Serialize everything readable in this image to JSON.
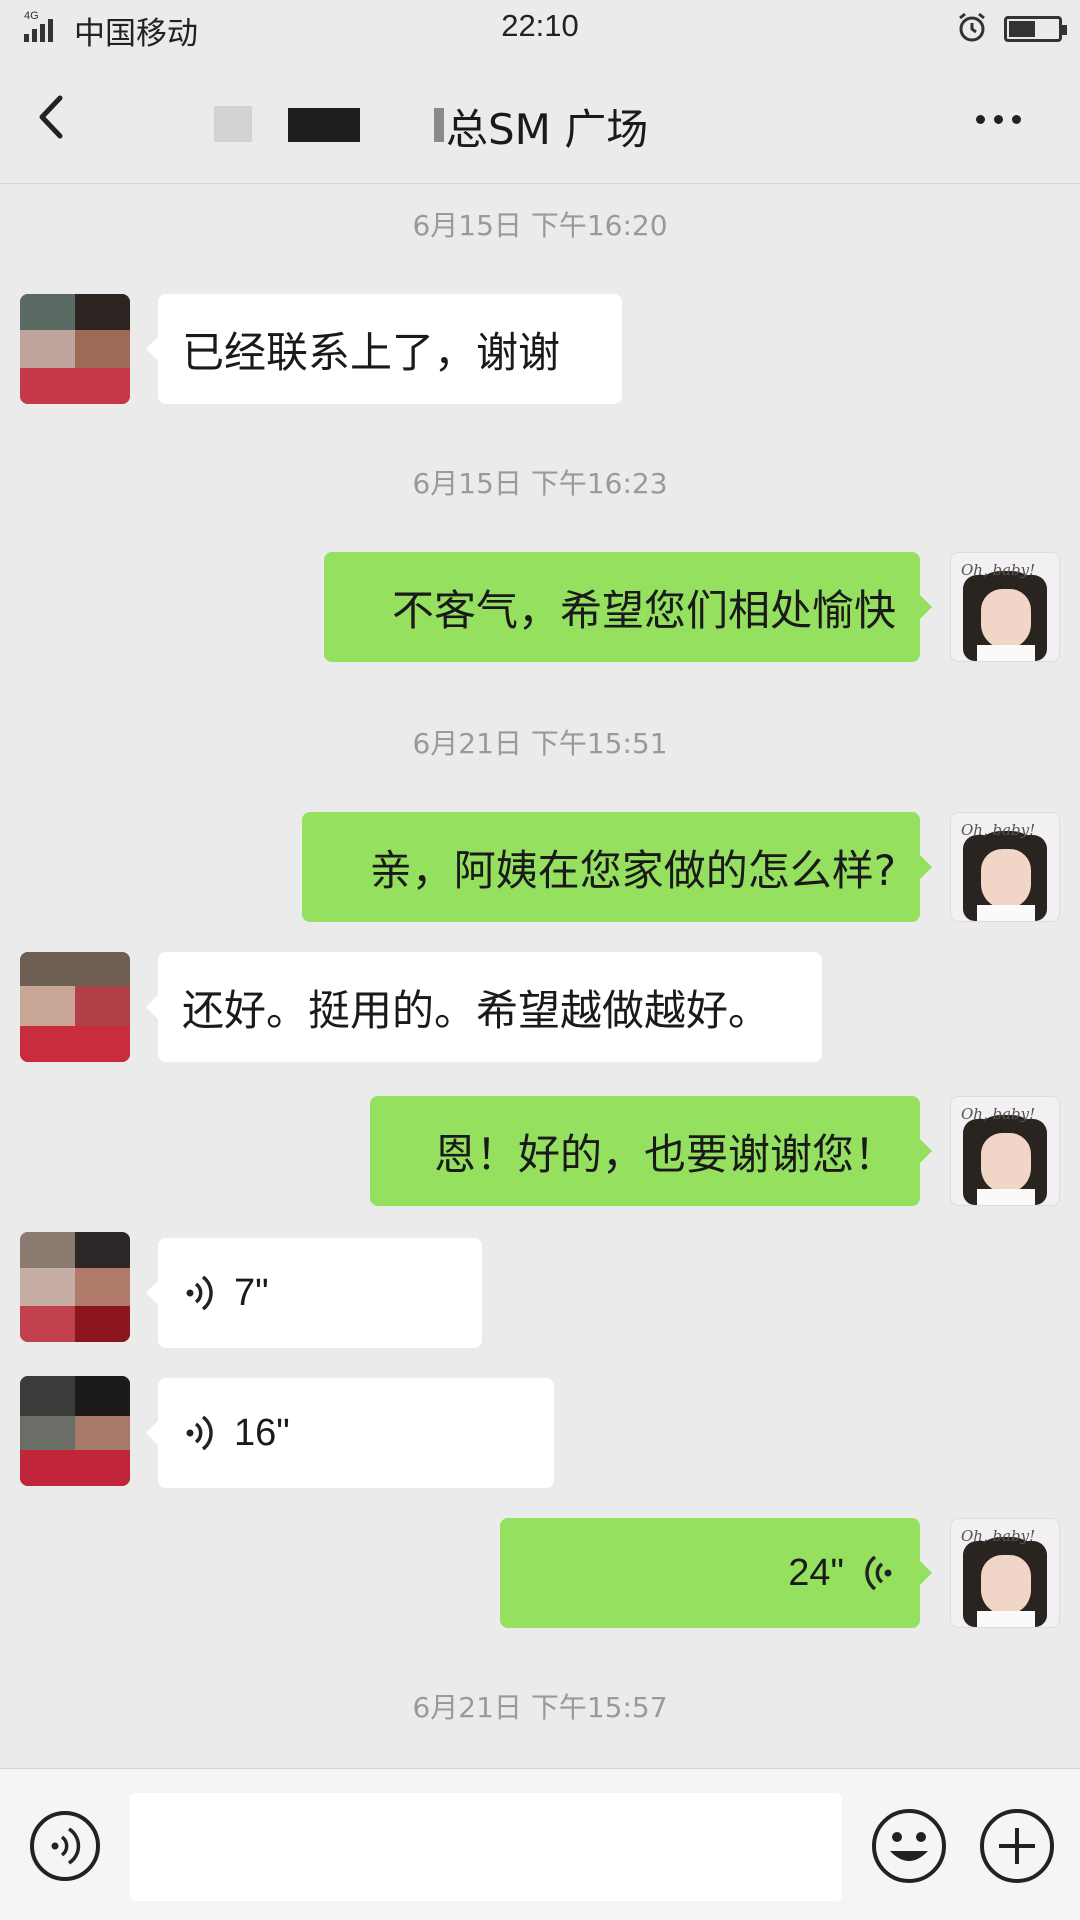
{
  "status_bar": {
    "network_tag": "4G",
    "carrier": "中国移动",
    "time": "22:10"
  },
  "header": {
    "title": "总SM 广场"
  },
  "messages": [
    {
      "type": "timestamp",
      "text": "6月15日 下午16:20"
    },
    {
      "type": "text",
      "side": "them",
      "text": "已经联系上了，谢谢"
    },
    {
      "type": "timestamp",
      "text": "6月15日 下午16:23"
    },
    {
      "type": "text",
      "side": "me",
      "text": "不客气，希望您们相处愉快"
    },
    {
      "type": "timestamp",
      "text": "6月21日 下午15:51"
    },
    {
      "type": "text",
      "side": "me",
      "text": "亲，阿姨在您家做的怎么样?"
    },
    {
      "type": "text",
      "side": "them",
      "text": "还好。挺用的。希望越做越好。"
    },
    {
      "type": "text",
      "side": "me",
      "text": "恩！好的，也要谢谢您！"
    },
    {
      "type": "voice",
      "side": "them",
      "duration": "7\""
    },
    {
      "type": "voice",
      "side": "them",
      "duration": "16\""
    },
    {
      "type": "voice",
      "side": "me",
      "duration": "24\""
    },
    {
      "type": "timestamp",
      "text": "6月21日 下午15:57"
    }
  ],
  "avatar_me_caption": "Oh, baby!",
  "input": {
    "placeholder": ""
  },
  "icons": {
    "back": "chevron-left-icon",
    "more": "more-dots-icon",
    "voice_toggle": "voice-icon",
    "emoji": "smiley-icon",
    "plus": "plus-circle-icon"
  },
  "colors": {
    "background": "#ebebeb",
    "my_bubble": "#95e15f",
    "their_bubble": "#ffffff",
    "timestamp": "#9a9a9a"
  }
}
